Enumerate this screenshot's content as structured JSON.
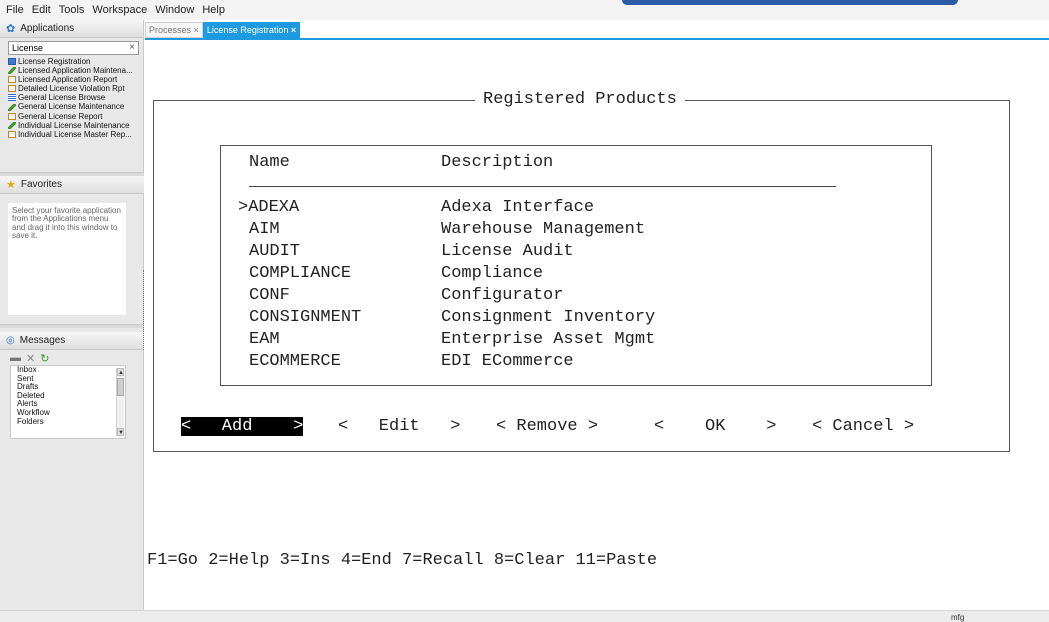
{
  "menu": [
    "File",
    "Edit",
    "Tools",
    "Workspace",
    "Window",
    "Help"
  ],
  "applications": {
    "title": "Applications",
    "search_value": "License",
    "clear_glyph": "×",
    "items": [
      {
        "icon": "form",
        "label": "License Registration"
      },
      {
        "icon": "pen",
        "label": "Licensed Application Maintena..."
      },
      {
        "icon": "report",
        "label": "Licensed Application Report"
      },
      {
        "icon": "report",
        "label": "Detailed License Violation Rpt"
      },
      {
        "icon": "list",
        "label": "General License Browse"
      },
      {
        "icon": "pen",
        "label": "General License Maintenance"
      },
      {
        "icon": "report",
        "label": "General License Report"
      },
      {
        "icon": "pen",
        "label": "Individual License Maintenance"
      },
      {
        "icon": "report",
        "label": "Individual License Master Rep..."
      }
    ]
  },
  "favorites": {
    "title": "Favorites",
    "hint": "Select your favorite application from the Applications menu and drag it into this window to save it."
  },
  "messages": {
    "title": "Messages",
    "folders": [
      "Inbox",
      "Sent",
      "Drafts",
      "Deleted",
      "Alerts",
      "Workflow",
      "Folders"
    ]
  },
  "tabs": [
    {
      "label": "Processes",
      "close": "×"
    },
    {
      "label": "License Registration",
      "close": "×"
    }
  ],
  "screen": {
    "title": "Registered Products",
    "col_name": "Name",
    "col_desc": "Description",
    "rows": [
      {
        "name": ">ADEXA",
        "desc": "Adexa Interface"
      },
      {
        "name": "AIM",
        "desc": "Warehouse Management"
      },
      {
        "name": "AUDIT",
        "desc": "License Audit"
      },
      {
        "name": "COMPLIANCE",
        "desc": "Compliance"
      },
      {
        "name": "CONF",
        "desc": "Configurator"
      },
      {
        "name": "CONSIGNMENT",
        "desc": "Consignment Inventory"
      },
      {
        "name": "EAM",
        "desc": "Enterprise Asset Mgmt"
      },
      {
        "name": "ECOMMERCE",
        "desc": "EDI ECommerce"
      }
    ],
    "buttons": {
      "add": "<   Add    >",
      "edit": "<   Edit   >",
      "remove": "< Remove >",
      "ok": "<    OK    >",
      "cancel": "< Cancel >"
    },
    "function_keys": "F1=Go 2=Help 3=Ins 4=End 7=Recall 8=Clear 11=Paste"
  },
  "status": {
    "user": "mfg"
  },
  "colors": {
    "accent": "#1e9be0",
    "selection": "#3f73c9"
  }
}
